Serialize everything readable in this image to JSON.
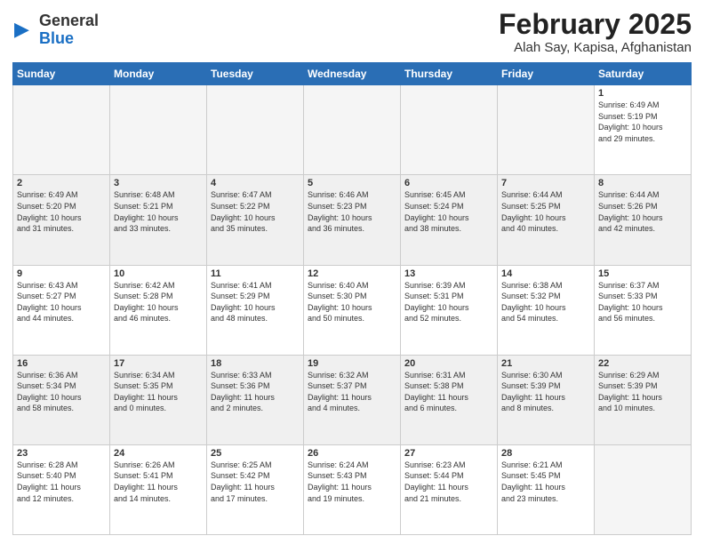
{
  "logo": {
    "general": "General",
    "blue": "Blue"
  },
  "title": "February 2025",
  "subtitle": "Alah Say, Kapisa, Afghanistan",
  "weekdays": [
    "Sunday",
    "Monday",
    "Tuesday",
    "Wednesday",
    "Thursday",
    "Friday",
    "Saturday"
  ],
  "weeks": [
    [
      {
        "day": "",
        "info": ""
      },
      {
        "day": "",
        "info": ""
      },
      {
        "day": "",
        "info": ""
      },
      {
        "day": "",
        "info": ""
      },
      {
        "day": "",
        "info": ""
      },
      {
        "day": "",
        "info": ""
      },
      {
        "day": "1",
        "info": "Sunrise: 6:49 AM\nSunset: 5:19 PM\nDaylight: 10 hours\nand 29 minutes."
      }
    ],
    [
      {
        "day": "2",
        "info": "Sunrise: 6:49 AM\nSunset: 5:20 PM\nDaylight: 10 hours\nand 31 minutes."
      },
      {
        "day": "3",
        "info": "Sunrise: 6:48 AM\nSunset: 5:21 PM\nDaylight: 10 hours\nand 33 minutes."
      },
      {
        "day": "4",
        "info": "Sunrise: 6:47 AM\nSunset: 5:22 PM\nDaylight: 10 hours\nand 35 minutes."
      },
      {
        "day": "5",
        "info": "Sunrise: 6:46 AM\nSunset: 5:23 PM\nDaylight: 10 hours\nand 36 minutes."
      },
      {
        "day": "6",
        "info": "Sunrise: 6:45 AM\nSunset: 5:24 PM\nDaylight: 10 hours\nand 38 minutes."
      },
      {
        "day": "7",
        "info": "Sunrise: 6:44 AM\nSunset: 5:25 PM\nDaylight: 10 hours\nand 40 minutes."
      },
      {
        "day": "8",
        "info": "Sunrise: 6:44 AM\nSunset: 5:26 PM\nDaylight: 10 hours\nand 42 minutes."
      }
    ],
    [
      {
        "day": "9",
        "info": "Sunrise: 6:43 AM\nSunset: 5:27 PM\nDaylight: 10 hours\nand 44 minutes."
      },
      {
        "day": "10",
        "info": "Sunrise: 6:42 AM\nSunset: 5:28 PM\nDaylight: 10 hours\nand 46 minutes."
      },
      {
        "day": "11",
        "info": "Sunrise: 6:41 AM\nSunset: 5:29 PM\nDaylight: 10 hours\nand 48 minutes."
      },
      {
        "day": "12",
        "info": "Sunrise: 6:40 AM\nSunset: 5:30 PM\nDaylight: 10 hours\nand 50 minutes."
      },
      {
        "day": "13",
        "info": "Sunrise: 6:39 AM\nSunset: 5:31 PM\nDaylight: 10 hours\nand 52 minutes."
      },
      {
        "day": "14",
        "info": "Sunrise: 6:38 AM\nSunset: 5:32 PM\nDaylight: 10 hours\nand 54 minutes."
      },
      {
        "day": "15",
        "info": "Sunrise: 6:37 AM\nSunset: 5:33 PM\nDaylight: 10 hours\nand 56 minutes."
      }
    ],
    [
      {
        "day": "16",
        "info": "Sunrise: 6:36 AM\nSunset: 5:34 PM\nDaylight: 10 hours\nand 58 minutes."
      },
      {
        "day": "17",
        "info": "Sunrise: 6:34 AM\nSunset: 5:35 PM\nDaylight: 11 hours\nand 0 minutes."
      },
      {
        "day": "18",
        "info": "Sunrise: 6:33 AM\nSunset: 5:36 PM\nDaylight: 11 hours\nand 2 minutes."
      },
      {
        "day": "19",
        "info": "Sunrise: 6:32 AM\nSunset: 5:37 PM\nDaylight: 11 hours\nand 4 minutes."
      },
      {
        "day": "20",
        "info": "Sunrise: 6:31 AM\nSunset: 5:38 PM\nDaylight: 11 hours\nand 6 minutes."
      },
      {
        "day": "21",
        "info": "Sunrise: 6:30 AM\nSunset: 5:39 PM\nDaylight: 11 hours\nand 8 minutes."
      },
      {
        "day": "22",
        "info": "Sunrise: 6:29 AM\nSunset: 5:39 PM\nDaylight: 11 hours\nand 10 minutes."
      }
    ],
    [
      {
        "day": "23",
        "info": "Sunrise: 6:28 AM\nSunset: 5:40 PM\nDaylight: 11 hours\nand 12 minutes."
      },
      {
        "day": "24",
        "info": "Sunrise: 6:26 AM\nSunset: 5:41 PM\nDaylight: 11 hours\nand 14 minutes."
      },
      {
        "day": "25",
        "info": "Sunrise: 6:25 AM\nSunset: 5:42 PM\nDaylight: 11 hours\nand 17 minutes."
      },
      {
        "day": "26",
        "info": "Sunrise: 6:24 AM\nSunset: 5:43 PM\nDaylight: 11 hours\nand 19 minutes."
      },
      {
        "day": "27",
        "info": "Sunrise: 6:23 AM\nSunset: 5:44 PM\nDaylight: 11 hours\nand 21 minutes."
      },
      {
        "day": "28",
        "info": "Sunrise: 6:21 AM\nSunset: 5:45 PM\nDaylight: 11 hours\nand 23 minutes."
      },
      {
        "day": "",
        "info": ""
      }
    ]
  ]
}
